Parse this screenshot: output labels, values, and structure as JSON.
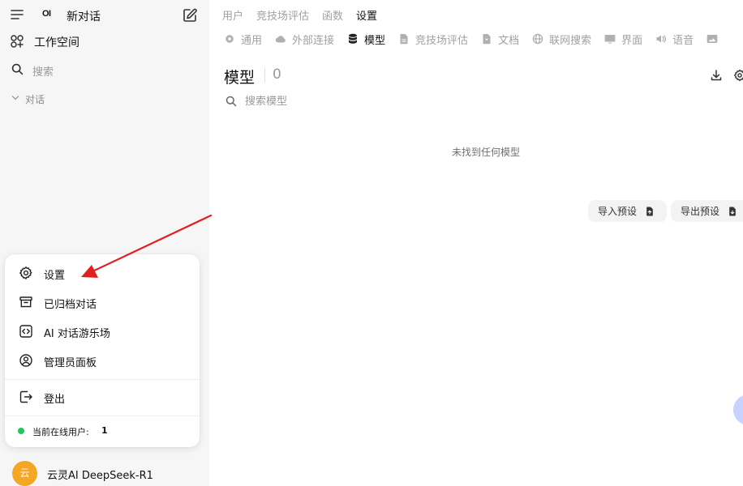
{
  "sidebar": {
    "logo": "OI",
    "new_chat": "新对话",
    "workspace": "工作空间",
    "search": "搜索",
    "conversations": "对话"
  },
  "user_menu": {
    "items": [
      "设置",
      "已归档对话",
      "AI 对话游乐场",
      "管理员面板"
    ],
    "logout": "登出",
    "online_label": "当前在线用户:",
    "online_count": "1"
  },
  "user": {
    "avatar": "云",
    "name": "云灵AI DeepSeek-R1"
  },
  "top_nav": [
    "用户",
    "竞技场评估",
    "函数",
    "设置"
  ],
  "settings_tabs": [
    "通用",
    "外部连接",
    "模型",
    "竞技场评估",
    "文档",
    "联网搜索",
    "界面",
    "语音"
  ],
  "models": {
    "title": "模型",
    "count": "0",
    "search_placeholder": "搜索模型",
    "empty": "未找到任何模型",
    "import_preset": "导入预设",
    "export_preset": "导出预设"
  },
  "colors": {
    "sidebar_bg": "#f6f6f6",
    "online_dot": "#22c55e",
    "avatar_bg": "#f5a623",
    "annotation_arrow": "#e02020"
  }
}
